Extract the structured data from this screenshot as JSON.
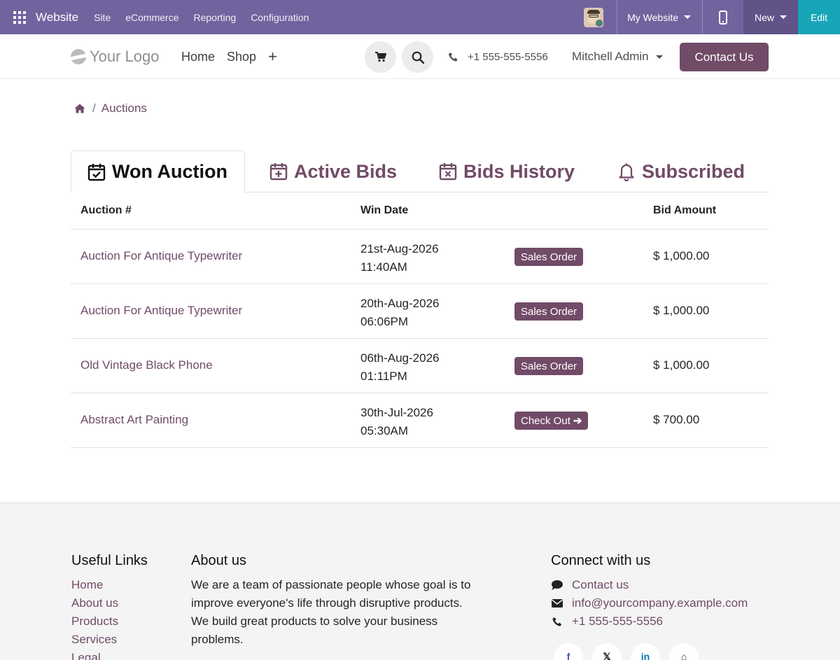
{
  "adminbar": {
    "brand": "Website",
    "menu": [
      "Site",
      "eCommerce",
      "Reporting",
      "Configuration"
    ],
    "website_selector": "My Website",
    "new_label": "New",
    "edit_label": "Edit",
    "colors": {
      "bar": "#71639e",
      "edit": "#18a5b8"
    }
  },
  "header": {
    "logo_text": "Your Logo",
    "nav": [
      "Home",
      "Shop",
      "+"
    ],
    "phone": "+1 555-555-5556",
    "user": "Mitchell Admin",
    "contact_button": "Contact Us",
    "icons": [
      "cart-icon",
      "search-icon",
      "phone-icon"
    ]
  },
  "breadcrumb": {
    "current": "Auctions"
  },
  "tabs": [
    {
      "label": "Won Auction",
      "icon": "calendar-check-icon",
      "active": true
    },
    {
      "label": "Active Bids",
      "icon": "calendar-plus-icon",
      "active": false
    },
    {
      "label": "Bids History",
      "icon": "calendar-x-icon",
      "active": false
    },
    {
      "label": "Subscribed",
      "icon": "bell-icon",
      "active": false
    }
  ],
  "table": {
    "columns": [
      "Auction #",
      "Win Date",
      "",
      "Bid Amount"
    ],
    "rows": [
      {
        "name": "Auction For Antique Typewriter",
        "date": "21st-Aug-2026",
        "time": "11:40AM",
        "action": "Sales Order",
        "amount": "$ 1,000.00"
      },
      {
        "name": "Auction For Antique Typewriter",
        "date": "20th-Aug-2026",
        "time": "06:06PM",
        "action": "Sales Order",
        "amount": "$ 1,000.00"
      },
      {
        "name": "Old Vintage Black Phone",
        "date": "06th-Aug-2026",
        "time": "01:11PM",
        "action": "Sales Order",
        "amount": "$ 1,000.00"
      },
      {
        "name": "Abstract Art Painting",
        "date": "30th-Jul-2026",
        "time": "05:30AM",
        "action": "Check Out",
        "amount": "$ 700.00"
      }
    ]
  },
  "footer": {
    "useful_links": {
      "title": "Useful Links",
      "links": [
        "Home",
        "About us",
        "Products",
        "Services",
        "Legal"
      ]
    },
    "about": {
      "title": "About us",
      "text": "We are a team of passionate people whose goal is to improve everyone's life through disruptive products. We build great products to solve your business problems."
    },
    "connect": {
      "title": "Connect with us",
      "items": [
        "Contact us",
        "info@yourcompany.example.com",
        "+1 555-555-5556"
      ]
    },
    "socials": [
      "f",
      "𝕏",
      "in",
      "⌂"
    ]
  },
  "accent_color": "#714b67"
}
